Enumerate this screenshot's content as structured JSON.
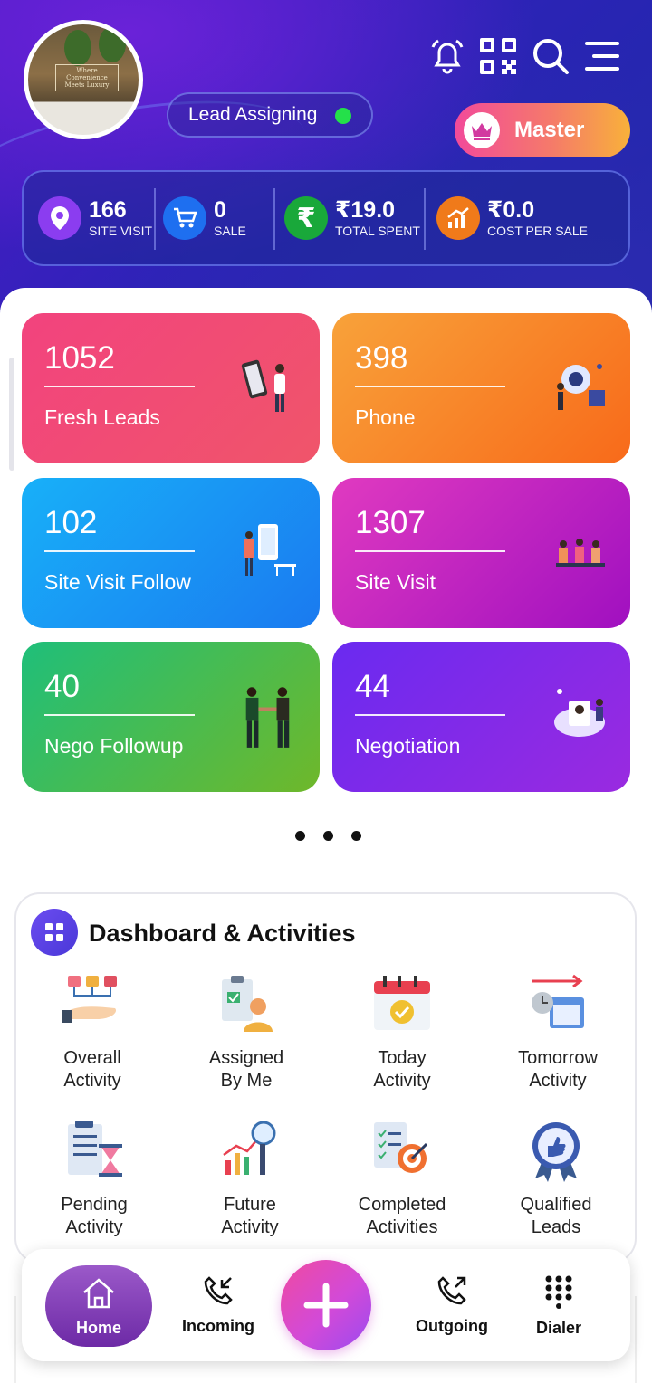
{
  "header": {
    "avatar_caption": "Where Convenience Meets Luxury",
    "lead_assigning_label": "Lead Assigning",
    "master_label": "Master",
    "icons": [
      "bell-icon",
      "qr-code-icon",
      "search-icon",
      "menu-icon"
    ]
  },
  "stats": [
    {
      "value": "166",
      "label": "SITE VISIT",
      "icon": "location-pin-icon",
      "color": "#8b3df0"
    },
    {
      "value": "0",
      "label": "SALE",
      "icon": "cart-icon",
      "color": "#1e6ff0"
    },
    {
      "value": "₹19.0",
      "label": "TOTAL SPENT",
      "icon": "rupee-icon",
      "color": "#19a83a"
    },
    {
      "value": "₹0.0",
      "label": "COST PER SALE",
      "icon": "growth-chart-icon",
      "color": "#f07a1a"
    }
  ],
  "cards": [
    {
      "value": "1052",
      "label": "Fresh Leads"
    },
    {
      "value": "398",
      "label": "Phone"
    },
    {
      "value": "102",
      "label": "Site Visit Follow"
    },
    {
      "value": "1307",
      "label": "Site Visit"
    },
    {
      "value": "40",
      "label": "Nego Followup"
    },
    {
      "value": "44",
      "label": "Negotiation"
    }
  ],
  "dashboard": {
    "title": "Dashboard & Activities",
    "items": [
      {
        "line1": "Overall",
        "line2": "Activity"
      },
      {
        "line1": "Assigned",
        "line2": "By Me"
      },
      {
        "line1": "Today",
        "line2": "Activity"
      },
      {
        "line1": "Tomorrow",
        "line2": "Activity"
      },
      {
        "line1": "Pending",
        "line2": "Activity"
      },
      {
        "line1": "Future",
        "line2": "Activity"
      },
      {
        "line1": "Completed",
        "line2": "Activities"
      },
      {
        "line1": "Qualified",
        "line2": "Leads"
      }
    ]
  },
  "nav": {
    "home": "Home",
    "incoming": "Incoming",
    "outgoing": "Outgoing",
    "dialer": "Dialer"
  }
}
